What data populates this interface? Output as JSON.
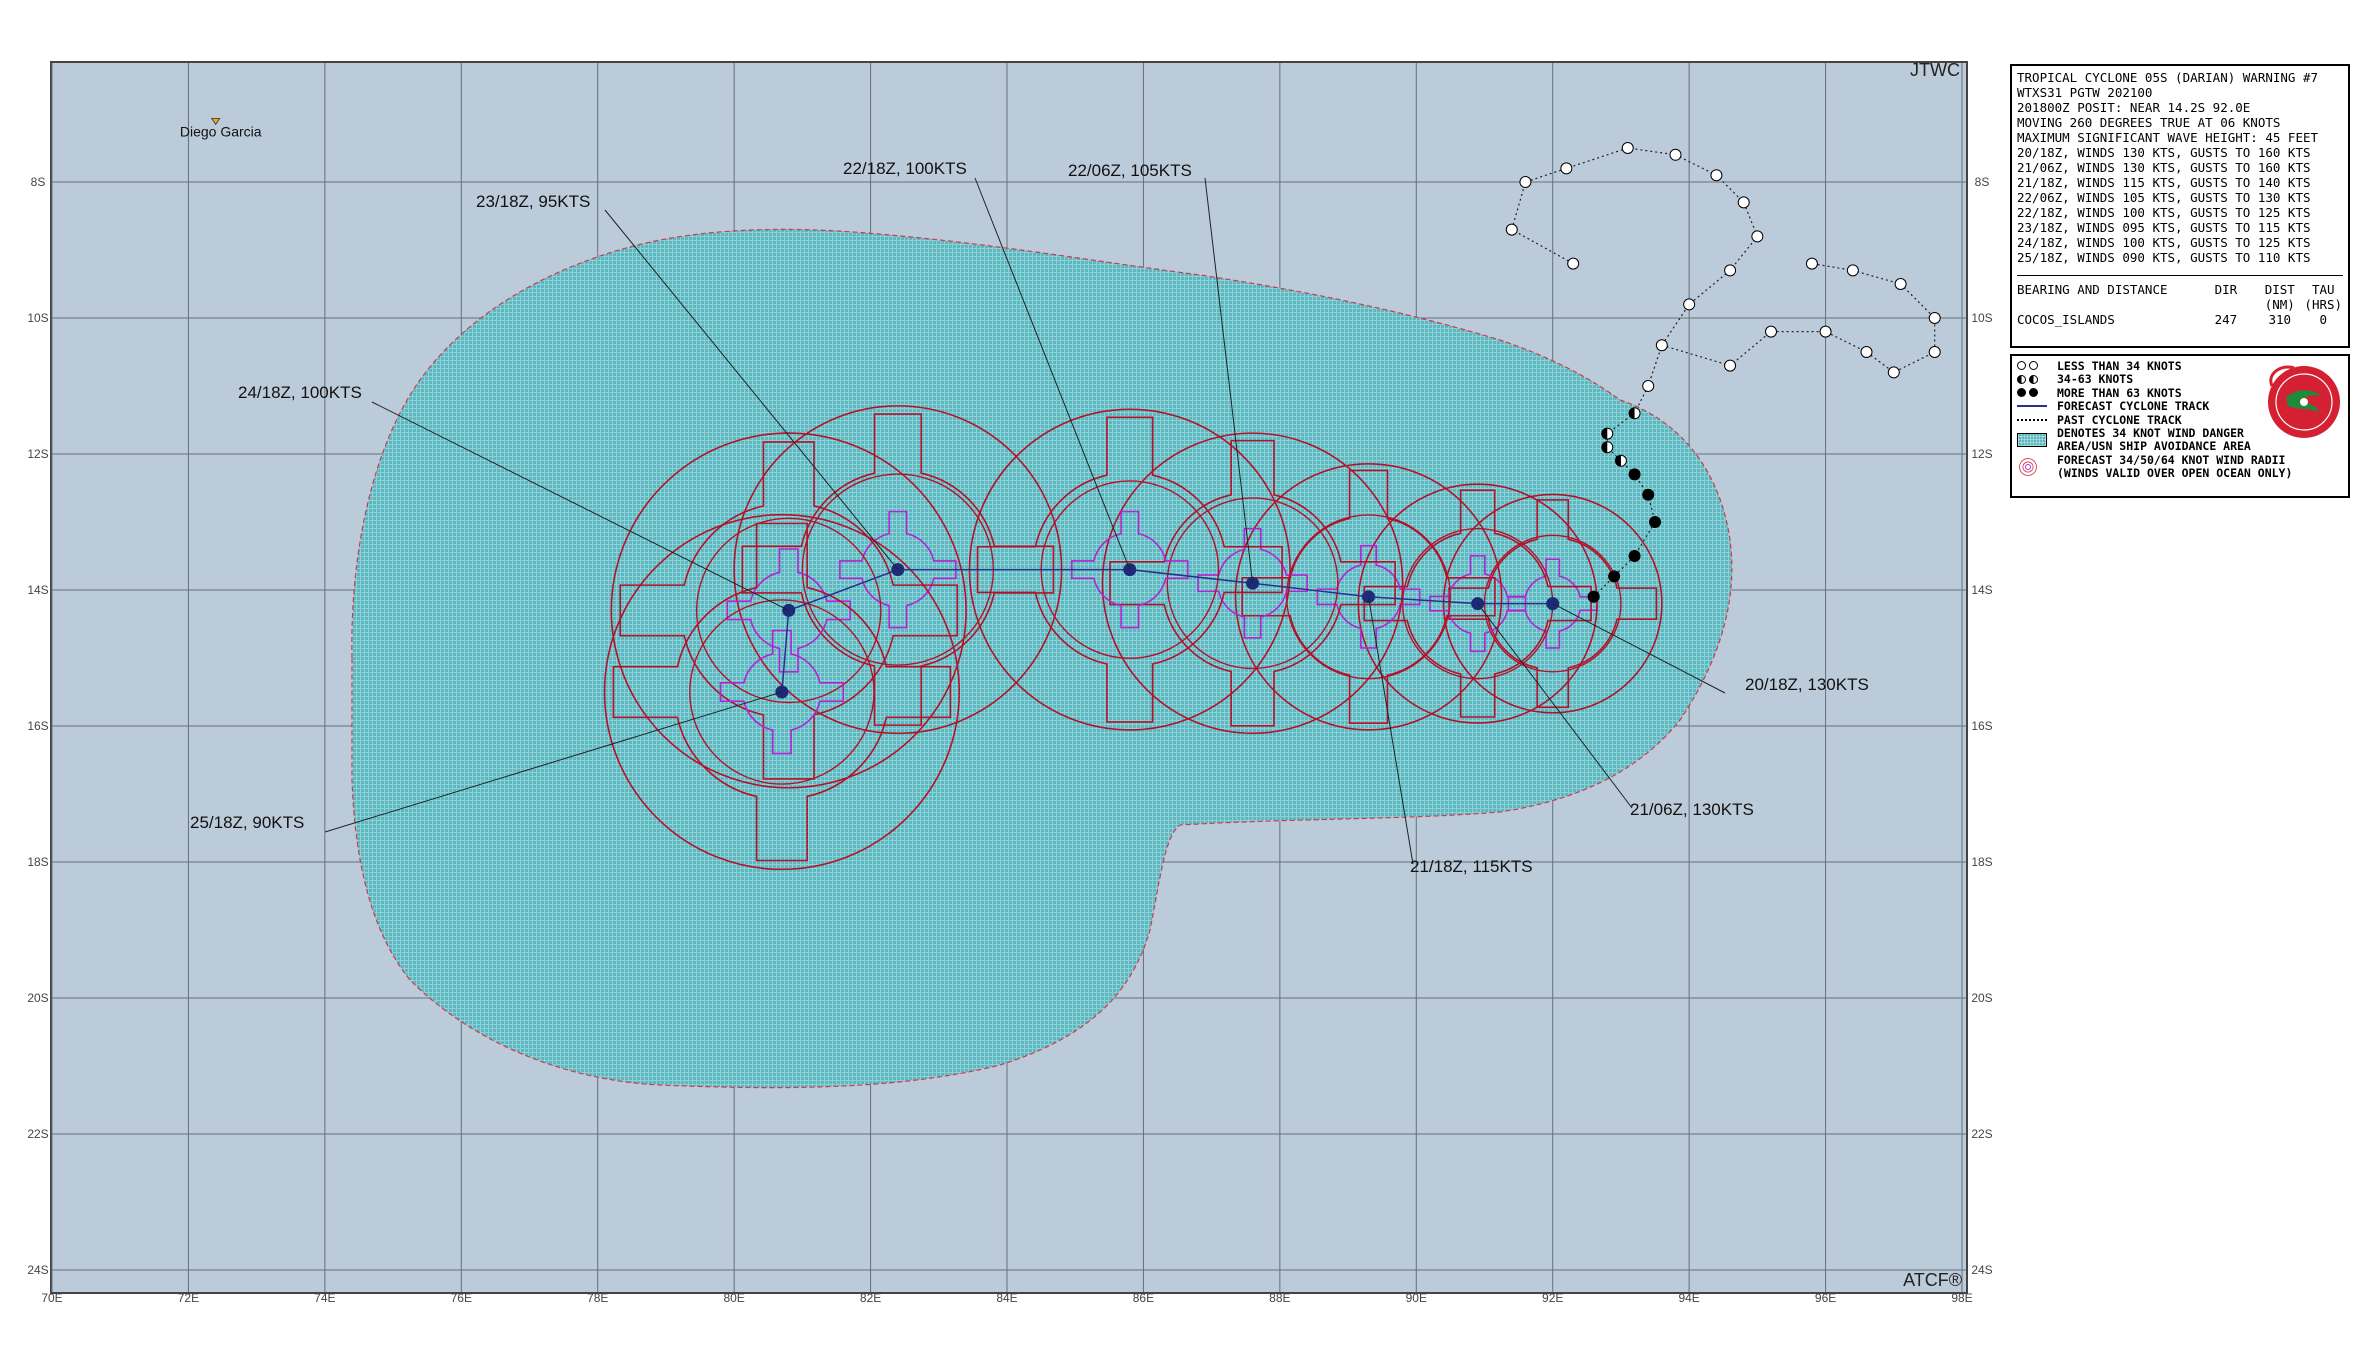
{
  "header": {
    "agency_top": "JTWC",
    "agency_bottom": "ATCF®"
  },
  "map": {
    "lon_labels": [
      "70E",
      "72E",
      "74E",
      "76E",
      "78E",
      "80E",
      "82E",
      "84E",
      "86E",
      "88E",
      "90E",
      "92E",
      "94E",
      "96E",
      "98E"
    ],
    "lat_labels": [
      "8S",
      "10S",
      "12S",
      "14S",
      "16S",
      "18S",
      "20S",
      "22S",
      "24S"
    ],
    "lon_range": [
      70,
      98
    ],
    "lat_range": [
      -6.25,
      -24.0
    ],
    "places": [
      {
        "name": "Diego Garcia",
        "lon": 72.4,
        "lat": -7.3
      }
    ],
    "colors": {
      "ocean": "#bccbd9",
      "danger_area": "#5bb8c0",
      "wind_radii_34": "#b5122a",
      "wind_radii_50": "#b5122a",
      "wind_radii_64": "#b822d4",
      "forecast_track": "#2b2f8c",
      "grid": "#62707c"
    }
  },
  "forecast_points": [
    {
      "label": "20/18Z, 130KTS",
      "lon": 92.0,
      "lat": -14.2,
      "r34": 1.6,
      "r50": 1.0,
      "r64": 0.65
    },
    {
      "label": "21/06Z, 130KTS",
      "lon": 90.9,
      "lat": -14.2,
      "r34": 1.75,
      "r50": 1.1,
      "r64": 0.7
    },
    {
      "label": "21/18Z, 115KTS",
      "lon": 89.3,
      "lat": -14.1,
      "r34": 1.95,
      "r50": 1.2,
      "r64": 0.75
    },
    {
      "label": "22/06Z, 105KTS",
      "lon": 87.6,
      "lat": -13.9,
      "r34": 2.2,
      "r50": 1.25,
      "r64": 0.8
    },
    {
      "label": "22/18Z, 100KTS",
      "lon": 85.8,
      "lat": -13.7,
      "r34": 2.35,
      "r50": 1.3,
      "r64": 0.85
    },
    {
      "label": "23/18Z,  95KTS",
      "lon": 82.4,
      "lat": -13.7,
      "r34": 2.4,
      "r50": 1.4,
      "r64": 0.85
    },
    {
      "label": "24/18Z, 100KTS",
      "lon": 80.8,
      "lat": -14.3,
      "r34": 2.6,
      "r50": 1.35,
      "r64": 0.9
    },
    {
      "label": "25/18Z,  90KTS",
      "lon": 80.7,
      "lat": -15.5,
      "r34": 2.6,
      "r50": 1.35,
      "r64": 0.9
    }
  ],
  "past_track": [
    {
      "lon": 93.5,
      "lat": -13.0,
      "cat": "hurricane"
    },
    {
      "lon": 93.4,
      "lat": -12.6,
      "cat": "hurricane"
    },
    {
      "lon": 93.2,
      "lat": -12.3,
      "cat": "hurricane"
    },
    {
      "lon": 93.2,
      "lat": -13.5,
      "cat": "hurricane"
    },
    {
      "lon": 92.9,
      "lat": -13.8,
      "cat": "hurricane"
    },
    {
      "lon": 92.6,
      "lat": -14.1,
      "cat": "hurricane"
    },
    {
      "lon": 93.0,
      "lat": -12.1,
      "cat": "storm"
    },
    {
      "lon": 92.8,
      "lat": -11.9,
      "cat": "storm"
    },
    {
      "lon": 92.8,
      "lat": -11.7,
      "cat": "storm"
    },
    {
      "lon": 93.2,
      "lat": -11.4,
      "cat": "storm"
    },
    {
      "lon": 93.4,
      "lat": -11.0,
      "cat": "depression"
    },
    {
      "lon": 93.6,
      "lat": -10.4,
      "cat": "depression"
    },
    {
      "lon": 94.0,
      "lat": -9.8,
      "cat": "depression"
    },
    {
      "lon": 94.6,
      "lat": -9.3,
      "cat": "depression"
    },
    {
      "lon": 95.0,
      "lat": -8.8,
      "cat": "depression"
    },
    {
      "lon": 94.8,
      "lat": -8.3,
      "cat": "depression"
    },
    {
      "lon": 94.4,
      "lat": -7.9,
      "cat": "depression"
    },
    {
      "lon": 93.8,
      "lat": -7.6,
      "cat": "depression"
    },
    {
      "lon": 93.1,
      "lat": -7.5,
      "cat": "depression"
    },
    {
      "lon": 92.2,
      "lat": -7.8,
      "cat": "depression"
    },
    {
      "lon": 91.6,
      "lat": -8.0,
      "cat": "depression"
    },
    {
      "lon": 91.4,
      "lat": -8.7,
      "cat": "depression"
    },
    {
      "lon": 92.3,
      "lat": -9.2,
      "cat": "depression"
    },
    {
      "lon": 94.6,
      "lat": -10.7,
      "cat": "depression"
    },
    {
      "lon": 95.2,
      "lat": -10.2,
      "cat": "depression"
    },
    {
      "lon": 96.0,
      "lat": -10.2,
      "cat": "depression"
    },
    {
      "lon": 96.6,
      "lat": -10.5,
      "cat": "depression"
    },
    {
      "lon": 97.0,
      "lat": -10.8,
      "cat": "depression"
    },
    {
      "lon": 97.6,
      "lat": -10.5,
      "cat": "depression"
    },
    {
      "lon": 97.6,
      "lat": -10.0,
      "cat": "depression"
    },
    {
      "lon": 97.1,
      "lat": -9.5,
      "cat": "depression"
    },
    {
      "lon": 96.4,
      "lat": -9.3,
      "cat": "depression"
    },
    {
      "lon": 95.8,
      "lat": -9.2,
      "cat": "depression"
    }
  ],
  "warning_text": {
    "lines": [
      "TROPICAL CYCLONE 05S (DARIAN) WARNING #7",
      "WTXS31 PGTW 202100",
      "201800Z POSIT: NEAR 14.2S 92.0E",
      "MOVING 260 DEGREES TRUE AT 06 KNOTS",
      "MAXIMUM SIGNIFICANT WAVE HEIGHT: 45 FEET",
      "20/18Z, WINDS 130 KTS, GUSTS TO 160 KTS",
      "21/06Z, WINDS 130 KTS, GUSTS TO 160 KTS",
      "21/18Z, WINDS 115 KTS, GUSTS TO 140 KTS",
      "22/06Z, WINDS 105 KTS, GUSTS TO 130 KTS",
      "22/18Z, WINDS 100 KTS, GUSTS TO 125 KTS",
      "23/18Z, WINDS 095 KTS, GUSTS TO 115 KTS",
      "24/18Z, WINDS 100 KTS, GUSTS TO 125 KTS",
      "25/18Z, WINDS 090 KTS, GUSTS TO 110 KTS"
    ],
    "bearing_header": {
      "col1": "BEARING AND DISTANCE",
      "col2": "DIR",
      "col3": "DIST",
      "col3b": "(NM)",
      "col4": "TAU",
      "col4b": "(HRS)"
    },
    "bearing_rows": [
      {
        "place": "COCOS_ISLANDS",
        "dir": "247",
        "dist": "310",
        "tau": "0"
      }
    ]
  },
  "legend": {
    "items": [
      "LESS THAN 34 KNOTS",
      "34-63 KNOTS",
      "MORE THAN 63 KNOTS",
      "FORECAST CYCLONE TRACK",
      "PAST CYCLONE TRACK",
      "DENOTES 34 KNOT WIND DANGER",
      "AREA/USN SHIP AVOIDANCE AREA",
      "FORECAST 34/50/64 KNOT WIND RADII",
      "(WINDS VALID OVER OPEN OCEAN ONLY)"
    ]
  }
}
